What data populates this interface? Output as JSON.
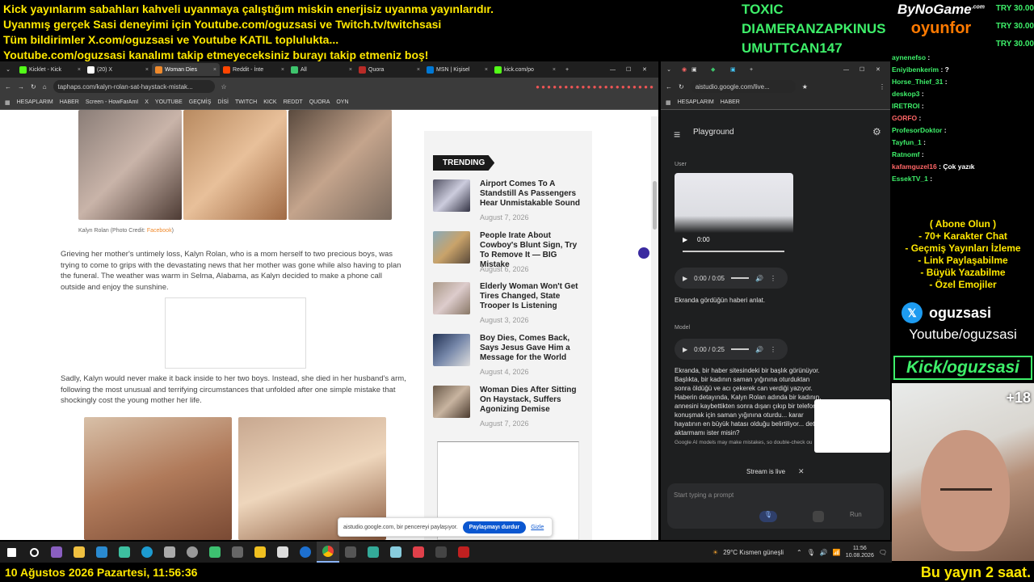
{
  "banner": {
    "l1": "Kick yayınlarım sabahları kahveli uyanmaya çalıştığım miskin enerjisiz uyanma yayınlarıdır.",
    "l2": "Uyanmış gerçek Sasi deneyimi için Youtube.com/oguzsasi ve Twitch.tv/twitchsasi",
    "l3": "Tüm bildirimler X.com/oguzsasi ve Youtube KATIL toplulukta...",
    "l4": "Youtube.com/oguzsasi kanalımı takip etmeyeceksiniz burayı takip etmeniz boş!"
  },
  "donors": [
    "TOXIC",
    "DIAMERANZAPKINUS",
    "UMUTTCAN147"
  ],
  "brand": {
    "top": "ByNoGame",
    "bottom": "oyunfor",
    "com": ".com"
  },
  "prices": [
    "TRY 30.00",
    "TRY 30.00",
    "TRY 30.00"
  ],
  "browser1": {
    "tabs": [
      "Kicklet - Kick",
      "(20) X",
      "Woman Dies",
      "Reddit - İnte",
      "All",
      "Quora",
      "MSN | Kişisel",
      "kick.com/po"
    ],
    "url": "taphaps.com/kalyn-rolan-sat-haystack-mistak...",
    "bookmarks": [
      "HESAPLARIM",
      "HABER",
      "Screen - HowFarAmI",
      "X",
      "YOUTUBE",
      "GEÇMİŞ",
      "DİSİ",
      "TWITCH",
      "KICK",
      "REDDT",
      "QUORA",
      "OYN"
    ],
    "caption": "Kalyn Rolan (Photo Credit: ",
    "caption_link": "Facebook",
    "caption_end": ")",
    "p1": "Grieving her mother's untimely loss, Kalyn Rolan, who is a mom herself to two precious boys, was trying to come to grips with the devastating news that her mother was gone while also having to plan the funeral. The weather was warm in Selma, Alabama, as Kalyn decided to make a phone call outside and enjoy the sunshine.",
    "p2": "Sadly, Kalyn would never make it back inside to her two boys. Instead, she died in her husband's arm, following the most unusual and terrifying circumstances that unfolded after one simple mistake that shockingly cost the young mother her life.",
    "trending_label": "TRENDING",
    "trending": [
      {
        "title": "Airport Comes To A Standstill As Passengers Hear Unmistakable Sound",
        "date": "August 7, 2026"
      },
      {
        "title": "People Irate About Cowboy's Blunt Sign, Try To Remove It — BIG Mistake",
        "date": "August 6, 2026"
      },
      {
        "title": "Elderly Woman Won't Get Tires Changed, State Trooper Is Listening",
        "date": "August 3, 2026"
      },
      {
        "title": "Boy Dies, Comes Back, Says Jesus Gave Him a Message for the World",
        "date": "August 4, 2026"
      },
      {
        "title": "Woman Dies After Sitting On Haystack, Suffers Agonizing Demise",
        "date": "August 7, 2026"
      }
    ],
    "share_text": "aistudio.google.com, bir pencereyi paylaşıyor.",
    "share_btn": "Paylaşmayı durdur",
    "share_hide": "Gizle"
  },
  "browser2": {
    "url": "aistudio.google.com/live...",
    "bookmarks": [
      "HESAPLARIM",
      "HABER"
    ],
    "title": "Playground",
    "user_label": "User",
    "video_time": "0:00",
    "audio1": "0:00 / 0:05",
    "user_msg": "Ekranda gördüğün haberi anlat.",
    "model_label": "Model",
    "audio2": "0:00 / 0:25",
    "model_msg": "Ekranda, bir haber sitesindeki bir başlık görünüyor. Başlıkta, bir kadının saman yığınına oturduktan sonra öldüğü ve acı çekerek can verdiği yazıyor. Haberin detayında, Kalyn Rolan adında bir kadının, annesini kaybettikten sonra dışarı çıkıp bir telefonla konuşmak için saman yığınına oturdu... karar hayatının en büyük hatası olduğu belirtiliyor... detay aktarmamı ister misin?",
    "disclaimer": "Google AI models may make mistakes, so double-check outputs.",
    "live": "Stream is live",
    "placeholder": "Start typing a prompt",
    "run": "Run"
  },
  "chat": [
    {
      "u": "aynenefso",
      "m": ":"
    },
    {
      "u": "Eniyibenkerim",
      "m": ": ?"
    },
    {
      "u": "Horse_Thief_31",
      "m": ":"
    },
    {
      "u": "deskop3",
      "m": ":"
    },
    {
      "u": "IRETROI",
      "m": ":"
    },
    {
      "u": "GORFO",
      "m": ":"
    },
    {
      "u": "ProfesorDoktor",
      "m": ":"
    },
    {
      "u": "Tayfun_1",
      "m": ":"
    },
    {
      "u": "Ratnomf",
      "m": ":"
    },
    {
      "u": "kafamguzel16",
      "m": ": Çok yazık"
    },
    {
      "u": "EssekTV_1",
      "m": ":"
    }
  ],
  "features": [
    "( Abone Olun )",
    "- 70+ Karakter Chat",
    "- Geçmiş Yayınları İzleme",
    "- Link Paylaşabilme",
    "- Büyük Yazabilme",
    "- Özel Emojiler"
  ],
  "social": {
    "x": "oguzsasi",
    "yt": "Youtube/oguzsasi",
    "kick": "Kick/oguzsasi"
  },
  "cam_plus": "+18",
  "taskbar": {
    "weather": "29°C  Kısmen güneşli",
    "time": "11:56",
    "date": "10.08.2026"
  },
  "bottom": {
    "date": "10 Ağustos 2026 Pazartesi, 11:56:36",
    "right": "Bu yayın 2 saat."
  }
}
